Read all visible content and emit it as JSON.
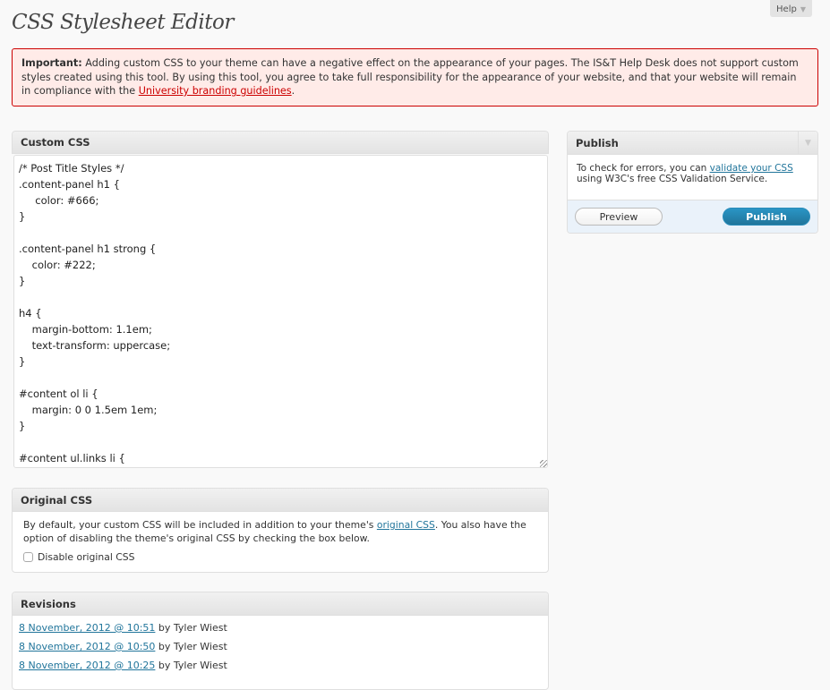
{
  "help_tab": {
    "label": "Help",
    "icon": "chevron-down-icon"
  },
  "page_title": "CSS Stylesheet Editor",
  "notice": {
    "strong": "Important:",
    "text": " Adding custom CSS to your theme can have a negative effect on the appearance of your pages. The IS&T Help Desk does not support custom styles created using this tool. By using this tool, you agree to take full responsibility for the appearance of your website, and that your website will remain in compliance with the ",
    "link": "University branding guidelines",
    "end": "."
  },
  "custom_css": {
    "title": "Custom CSS",
    "content": "/* Post Title Styles */\n.content-panel h1 {\n     color: #666;\n}\n\n.content-panel h1 strong {\n    color: #222;\n}\n\nh4 {\n    margin-bottom: 1.1em;\n    text-transform: uppercase;\n}\n\n#content ol li {\n    margin: 0 0 1.5em 1em;\n}\n\n#content ul.links li {"
  },
  "publish": {
    "title": "Publish",
    "text_before": "To check for errors, you can ",
    "link": "validate your CSS",
    "text_after": " using W3C's free CSS Validation Service.",
    "preview_label": "Preview",
    "publish_label": "Publish"
  },
  "original_css": {
    "title": "Original CSS",
    "text_before": "By default, your custom CSS will be included in addition to your theme's ",
    "link": "original CSS",
    "text_after": ". You also have the option of disabling the theme's original CSS by checking the box below.",
    "checkbox_label": "Disable original CSS",
    "checkbox_checked": false
  },
  "revisions": {
    "title": "Revisions",
    "items": [
      {
        "date": "8 November, 2012 @ 10:51",
        "author": " by Tyler Wiest"
      },
      {
        "date": "8 November, 2012 @ 10:50",
        "author": " by Tyler Wiest"
      },
      {
        "date": "8 November, 2012 @ 10:25",
        "author": " by Tyler Wiest"
      }
    ]
  }
}
